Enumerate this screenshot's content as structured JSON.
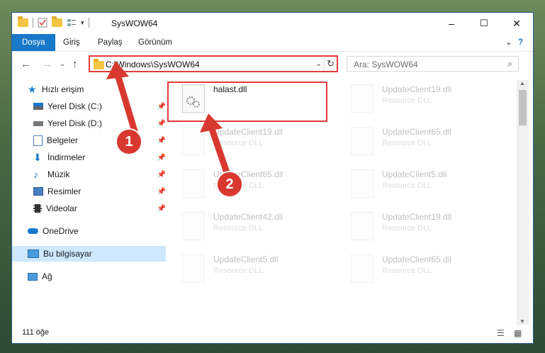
{
  "window": {
    "title": "SysWOW64",
    "minimize": "–",
    "maximize": "☐",
    "close": "✕"
  },
  "ribbon": {
    "tabs": [
      "Dosya",
      "Giriş",
      "Paylaş",
      "Görünüm"
    ],
    "help": "?"
  },
  "address": {
    "path": "C:\\Windows\\SysWOW64",
    "search_placeholder": "Ara: SysWOW64"
  },
  "nav": {
    "quick_access": "Hızlı erişim",
    "items": [
      "Yerel Disk (C:)",
      "Yerel Disk (D:)",
      "Belgeler",
      "İndirmeler",
      "Müzik",
      "Resimler",
      "Videolar"
    ],
    "onedrive": "OneDrive",
    "this_pc": "Bu bilgisayar",
    "network": "Ağ"
  },
  "files": {
    "main": {
      "name": "halast.dll"
    },
    "left": [
      {
        "name": "UpdateClient19.dll",
        "type": "Resource DLL"
      },
      {
        "name": "UpdateClient65.dll",
        "type": "Resource DLL"
      },
      {
        "name": "UpdateClient42.dll",
        "type": "Resource DLL"
      },
      {
        "name": "UpdateClient5.dll",
        "type": "Resource DLL"
      }
    ],
    "right": [
      {
        "name": "UpdateClient19.dll",
        "type": "Resource DLL"
      },
      {
        "name": "UpdateClient65.dll",
        "type": "Resource DLL"
      },
      {
        "name": "UpdateClient5.dll",
        "type": "Resource DLL"
      },
      {
        "name": "UpdateClient19.dll",
        "type": "Resource DLL"
      },
      {
        "name": "UpdateClient65.dll",
        "type": "Resource DLL"
      }
    ]
  },
  "status": {
    "count": "111 öğe"
  },
  "annotations": {
    "step1": "1",
    "step2": "2"
  },
  "colors": {
    "accent": "#1979ca",
    "highlight": "#e23b3b"
  }
}
